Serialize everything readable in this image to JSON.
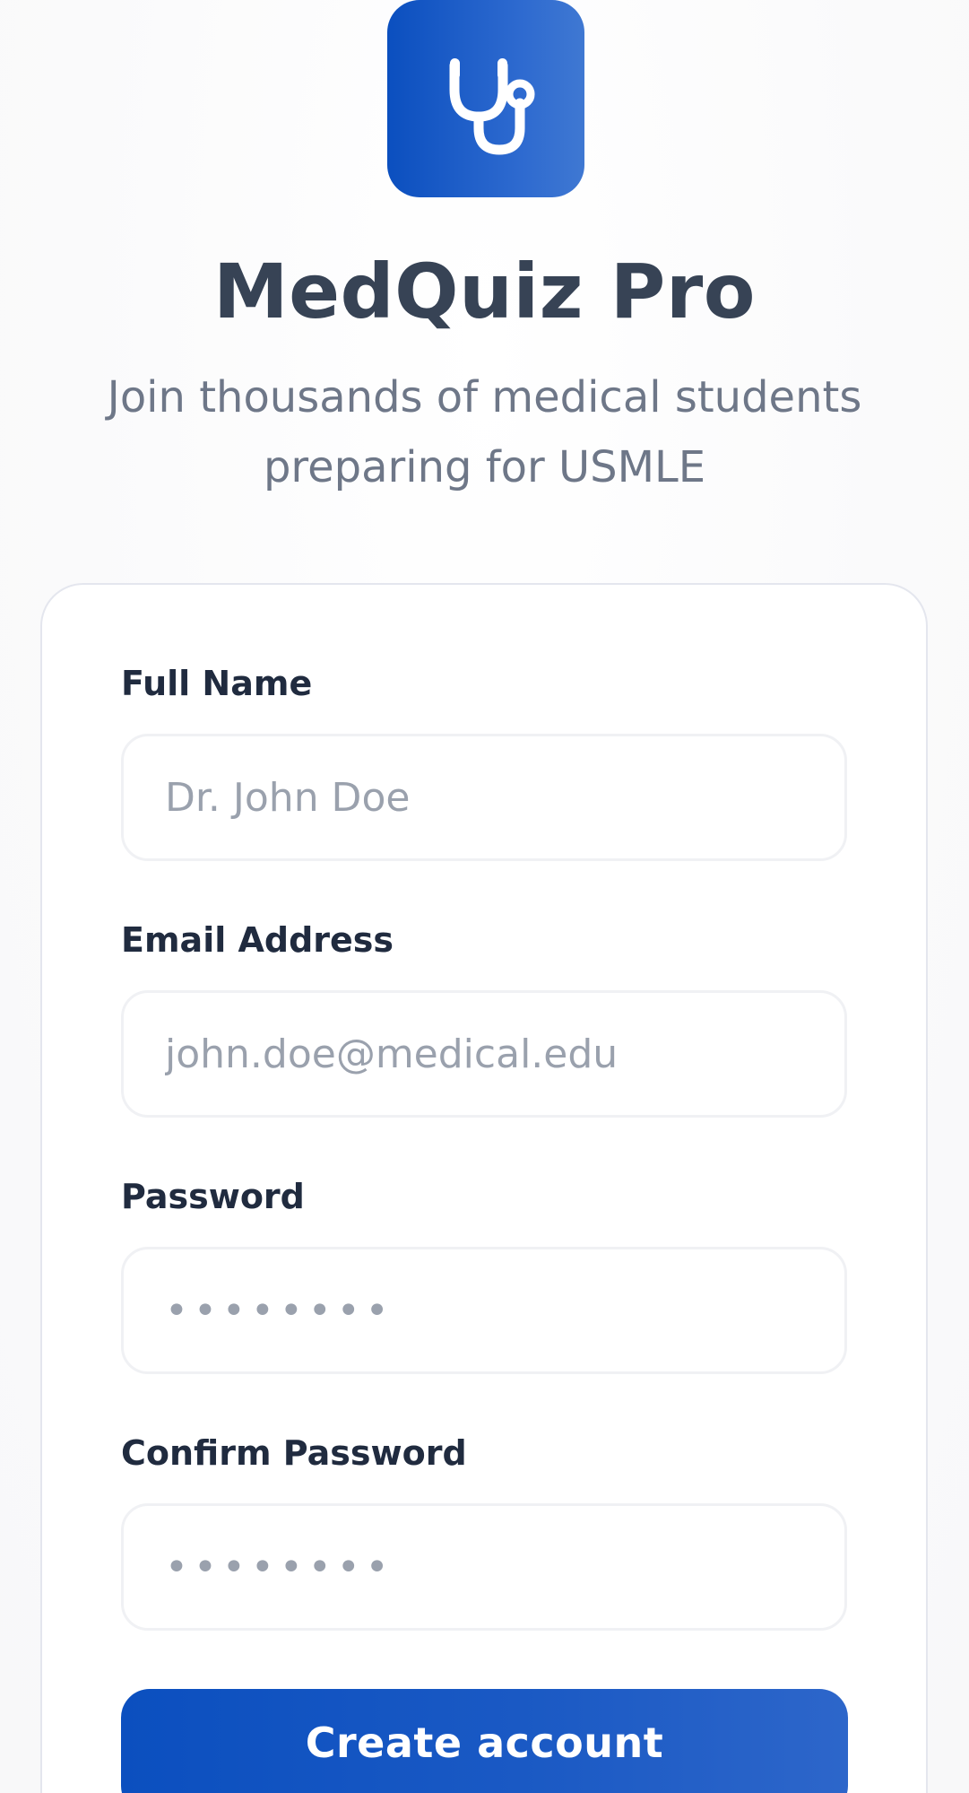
{
  "app": {
    "logo_icon": "stethoscope-icon",
    "title": "MedQuiz Pro",
    "subtitle": "Join thousands of medical students preparing for USMLE"
  },
  "form": {
    "fields": [
      {
        "label": "Full Name",
        "placeholder": "Dr. John Doe",
        "value": ""
      },
      {
        "label": "Email Address",
        "placeholder": "john.doe@medical.edu",
        "value": ""
      },
      {
        "label": "Password",
        "placeholder": "••••••••",
        "value": ""
      },
      {
        "label": "Confirm Password",
        "placeholder": "••••••••",
        "value": ""
      }
    ],
    "submit_label": "Create account"
  },
  "colors": {
    "brand_primary": "#0b4fbf",
    "brand_light": "#3f78d2",
    "title_text": "#374355",
    "subtitle_text": "#6e7788",
    "label_text": "#202b3f",
    "placeholder_text": "#9aa1ad",
    "card_border": "#e4e6ee",
    "input_border": "#f0f1f4"
  }
}
